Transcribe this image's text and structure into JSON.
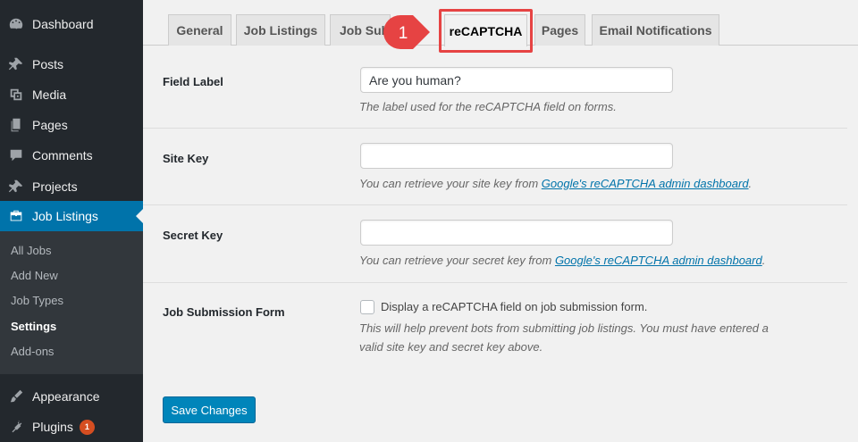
{
  "sidebar": {
    "items": [
      {
        "label": "Dashboard",
        "icon": "dashboard-icon"
      },
      {
        "label": "Posts",
        "icon": "pushpin-icon"
      },
      {
        "label": "Media",
        "icon": "media-icon"
      },
      {
        "label": "Pages",
        "icon": "pages-icon"
      },
      {
        "label": "Comments",
        "icon": "comment-icon"
      },
      {
        "label": "Projects",
        "icon": "pushpin-icon"
      },
      {
        "label": "Job Listings",
        "icon": "briefcase-icon"
      },
      {
        "label": "Appearance",
        "icon": "paintbrush-icon"
      },
      {
        "label": "Plugins",
        "icon": "plug-icon",
        "badge": "1"
      }
    ],
    "submenu": [
      "All Jobs",
      "Add New",
      "Job Types",
      "Settings",
      "Add-ons"
    ]
  },
  "tabs": [
    "General",
    "Job Listings",
    "Job Sub",
    "reCAPTCHA",
    "Pages",
    "Email Notifications"
  ],
  "callout": "1",
  "form": {
    "field_label": {
      "label": "Field Label",
      "value": "Are you human?",
      "desc": "The label used for the reCAPTCHA field on forms."
    },
    "site_key": {
      "label": "Site Key",
      "value": "",
      "desc_prefix": "You can retrieve your site key from ",
      "desc_link": "Google's reCAPTCHA admin dashboard",
      "desc_suffix": "."
    },
    "secret_key": {
      "label": "Secret Key",
      "value": "",
      "desc_prefix": "You can retrieve your secret key from ",
      "desc_link": "Google's reCAPTCHA admin dashboard",
      "desc_suffix": "."
    },
    "job_submission": {
      "label": "Job Submission Form",
      "checkbox_label": "Display a reCAPTCHA field on job submission form.",
      "desc_line1": "This will help prevent bots from submitting job listings. You must have entered a",
      "desc_line2": "valid site key and secret key above."
    }
  },
  "save_label": "Save Changes",
  "colors": {
    "accent": "#0073aa",
    "highlight": "#e64343",
    "sidebar": "#23282d"
  }
}
